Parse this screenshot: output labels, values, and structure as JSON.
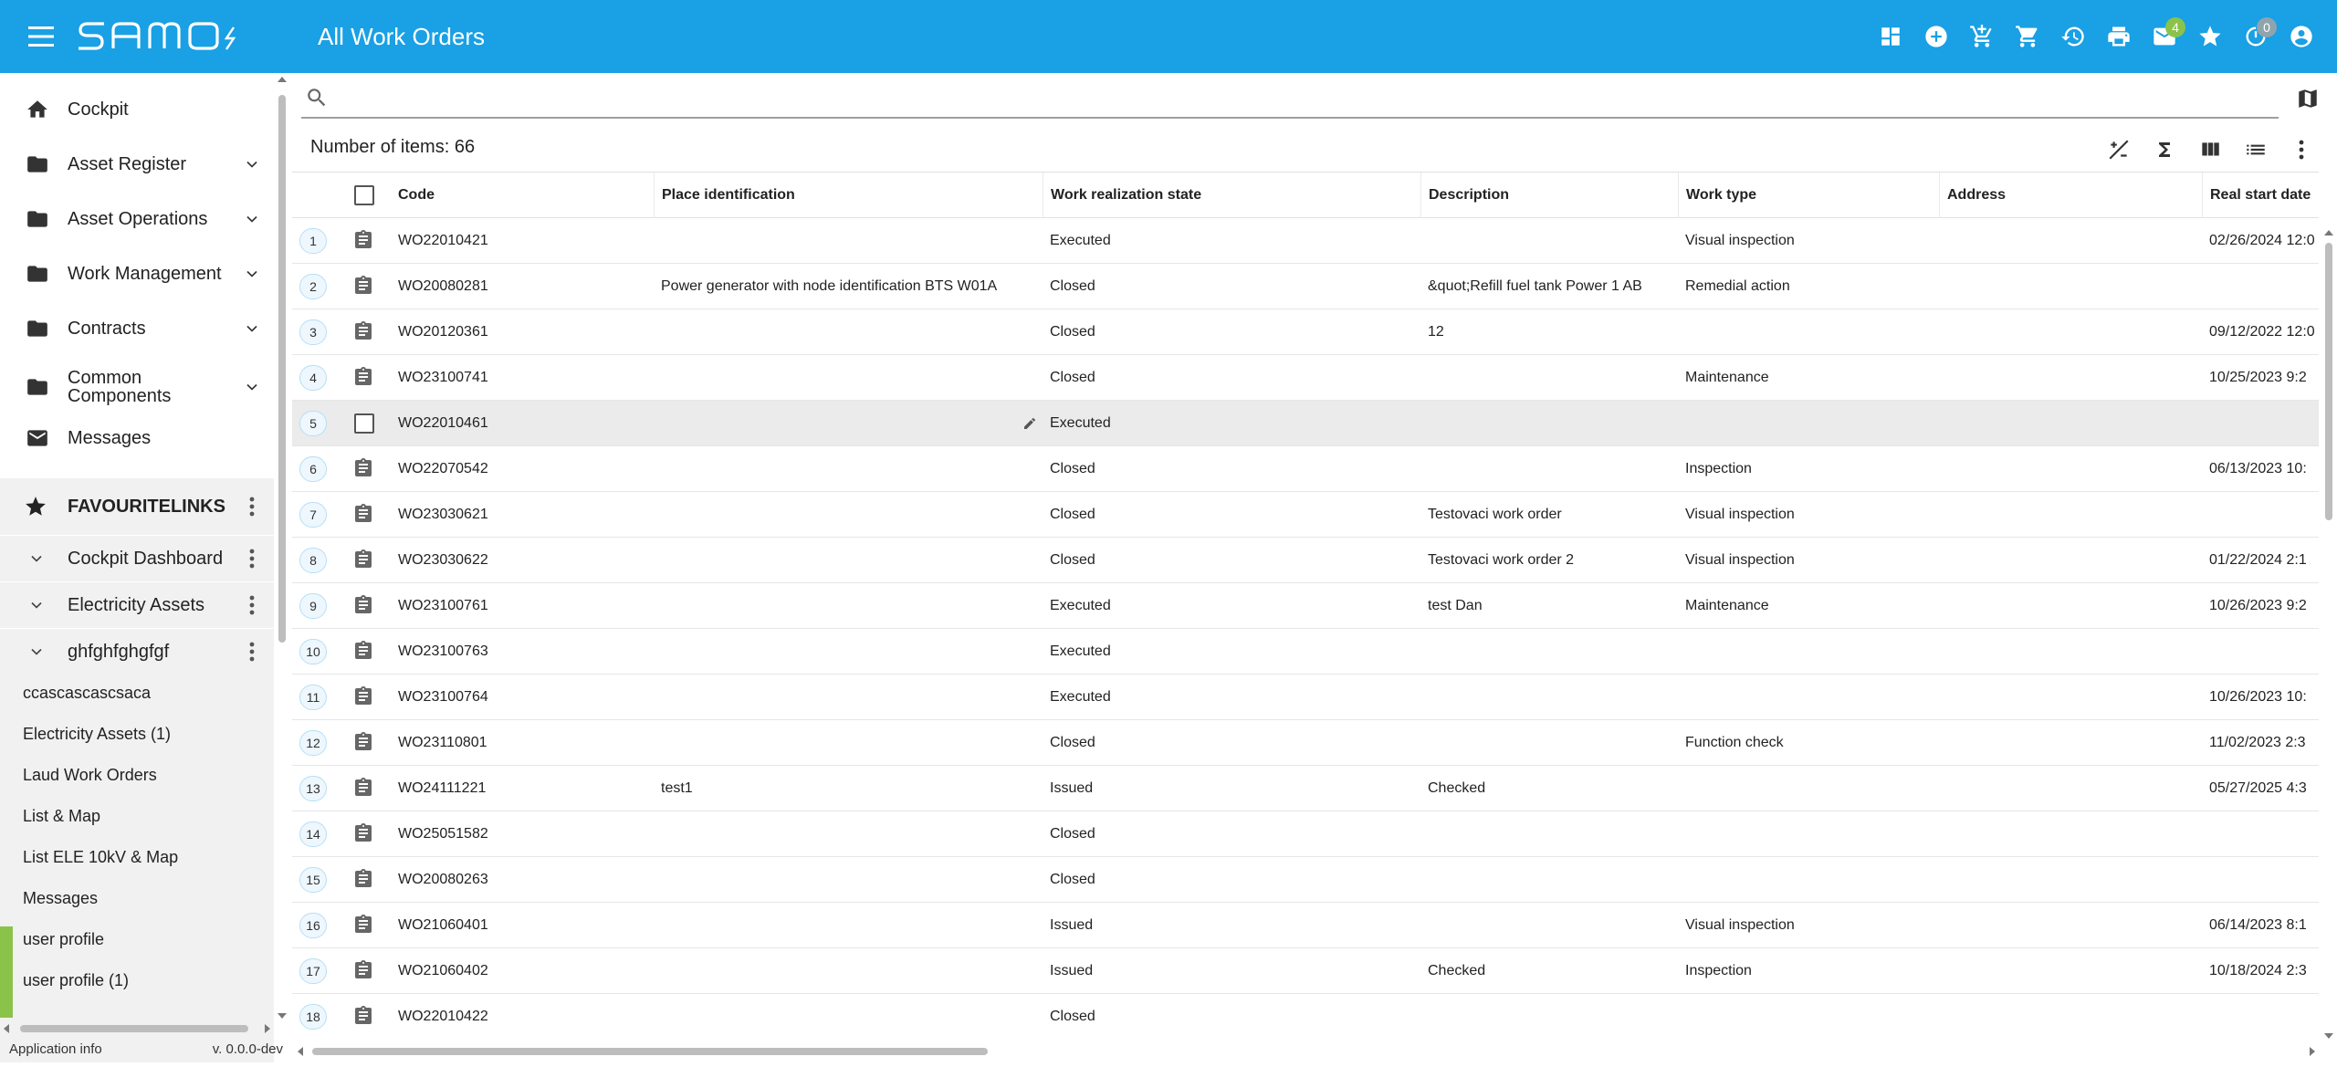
{
  "header": {
    "title": "All Work Orders",
    "logo_text": "samo",
    "icons": [
      "dashboard-icon",
      "add-circle-icon",
      "cart-add-icon",
      "cart-icon",
      "history-icon",
      "print-icon",
      "mail-icon",
      "star-icon",
      "timer-icon",
      "account-icon"
    ],
    "mail_badge": "4",
    "timer_badge": "0",
    "mail_badge_color": "#8bc34a",
    "timer_badge_color": "#90a4ae"
  },
  "sidebar": {
    "nav": [
      {
        "label": "Cockpit",
        "icon": "home-icon",
        "expandable": false
      },
      {
        "label": "Asset Register",
        "icon": "folder-icon",
        "expandable": true
      },
      {
        "label": "Asset Operations",
        "icon": "folder-icon",
        "expandable": true
      },
      {
        "label": "Work Management",
        "icon": "folder-icon",
        "expandable": true
      },
      {
        "label": "Contracts",
        "icon": "folder-icon",
        "expandable": true
      },
      {
        "label": "Common Components",
        "icon": "folder-icon",
        "expandable": true
      },
      {
        "label": "Messages",
        "icon": "mail-icon",
        "expandable": false
      }
    ],
    "favourites_label": "FAVOURITELINKS",
    "fav_groups": [
      {
        "label": "Cockpit Dashboard"
      },
      {
        "label": "Electricity Assets"
      },
      {
        "label": "ghfghfghgfgf"
      }
    ],
    "links": [
      {
        "label": "ccascascascsaca"
      },
      {
        "label": "Electricity Assets (1)"
      },
      {
        "label": "Laud Work Orders"
      },
      {
        "label": "List & Map"
      },
      {
        "label": "List ELE 10kV & Map"
      },
      {
        "label": "Messages"
      },
      {
        "label": "user profile"
      },
      {
        "label": "user profile (1)"
      }
    ],
    "app_info_label": "Application info",
    "version": "v. 0.0.0-dev"
  },
  "search": {
    "placeholder": "",
    "value": ""
  },
  "list": {
    "count_label": "Number of items: 66",
    "tools": [
      "formula-icon",
      "sum-icon",
      "columns-icon",
      "list-view-icon",
      "more-vert-icon"
    ],
    "columns": [
      "Code",
      "Place identification",
      "Work realization state",
      "Description",
      "Work type",
      "Address",
      "Real start date"
    ],
    "rows": [
      {
        "num": "1",
        "code": "WO22010421",
        "place": "",
        "state": "Executed",
        "desc": "",
        "type": "Visual inspection",
        "addr": "",
        "start": "02/26/2024 12:0"
      },
      {
        "num": "2",
        "code": "WO20080281",
        "place": "Power generator with node identification BTS W01A",
        "state": "Closed",
        "desc": "&quot;Refill fuel tank Power 1 AB",
        "type": "Remedial action",
        "addr": "",
        "start": ""
      },
      {
        "num": "3",
        "code": "WO20120361",
        "place": "",
        "state": "Closed",
        "desc": "12",
        "type": "",
        "addr": "",
        "start": "09/12/2022 12:0"
      },
      {
        "num": "4",
        "code": "WO23100741",
        "place": "",
        "state": "Closed",
        "desc": "",
        "type": "Maintenance",
        "addr": "",
        "start": "10/25/2023 9:2"
      },
      {
        "num": "5",
        "code": "WO22010461",
        "place": "",
        "state": "Executed",
        "desc": "",
        "type": "",
        "addr": "",
        "start": "",
        "highlight": true
      },
      {
        "num": "6",
        "code": "WO22070542",
        "place": "",
        "state": "Closed",
        "desc": "",
        "type": "Inspection",
        "addr": "",
        "start": "06/13/2023 10:"
      },
      {
        "num": "7",
        "code": "WO23030621",
        "place": "",
        "state": "Closed",
        "desc": "Testovaci work order",
        "type": "Visual inspection",
        "addr": "",
        "start": ""
      },
      {
        "num": "8",
        "code": "WO23030622",
        "place": "",
        "state": "Closed",
        "desc": "Testovaci work order 2",
        "type": "Visual inspection",
        "addr": "",
        "start": "01/22/2024 2:1"
      },
      {
        "num": "9",
        "code": "WO23100761",
        "place": "",
        "state": "Executed",
        "desc": "test Dan",
        "type": "Maintenance",
        "addr": "",
        "start": "10/26/2023 9:2"
      },
      {
        "num": "10",
        "code": "WO23100763",
        "place": "",
        "state": "Executed",
        "desc": "",
        "type": "",
        "addr": "",
        "start": ""
      },
      {
        "num": "11",
        "code": "WO23100764",
        "place": "",
        "state": "Executed",
        "desc": "",
        "type": "",
        "addr": "",
        "start": "10/26/2023 10:"
      },
      {
        "num": "12",
        "code": "WO23110801",
        "place": "",
        "state": "Closed",
        "desc": "",
        "type": "Function check",
        "addr": "",
        "start": "11/02/2023 2:3"
      },
      {
        "num": "13",
        "code": "WO24111221",
        "place": "test1",
        "state": "Issued",
        "desc": "Checked",
        "type": "",
        "addr": "",
        "start": "05/27/2025 4:3"
      },
      {
        "num": "14",
        "code": "WO25051582",
        "place": "",
        "state": "Closed",
        "desc": "",
        "type": "",
        "addr": "",
        "start": ""
      },
      {
        "num": "15",
        "code": "WO20080263",
        "place": "",
        "state": "Closed",
        "desc": "",
        "type": "",
        "addr": "",
        "start": ""
      },
      {
        "num": "16",
        "code": "WO21060401",
        "place": "",
        "state": "Issued",
        "desc": "",
        "type": "Visual inspection",
        "addr": "",
        "start": "06/14/2023 8:1"
      },
      {
        "num": "17",
        "code": "WO21060402",
        "place": "",
        "state": "Issued",
        "desc": "Checked",
        "type": "Inspection",
        "addr": "",
        "start": "10/18/2024 2:3"
      },
      {
        "num": "18",
        "code": "WO22010422",
        "place": "",
        "state": "Closed",
        "desc": "",
        "type": "",
        "addr": "",
        "start": ""
      }
    ]
  },
  "colors": {
    "primary": "#1aa0e4",
    "sidebar_fav_bg": "#f1f1f1",
    "accent_green": "#8bc34a"
  }
}
